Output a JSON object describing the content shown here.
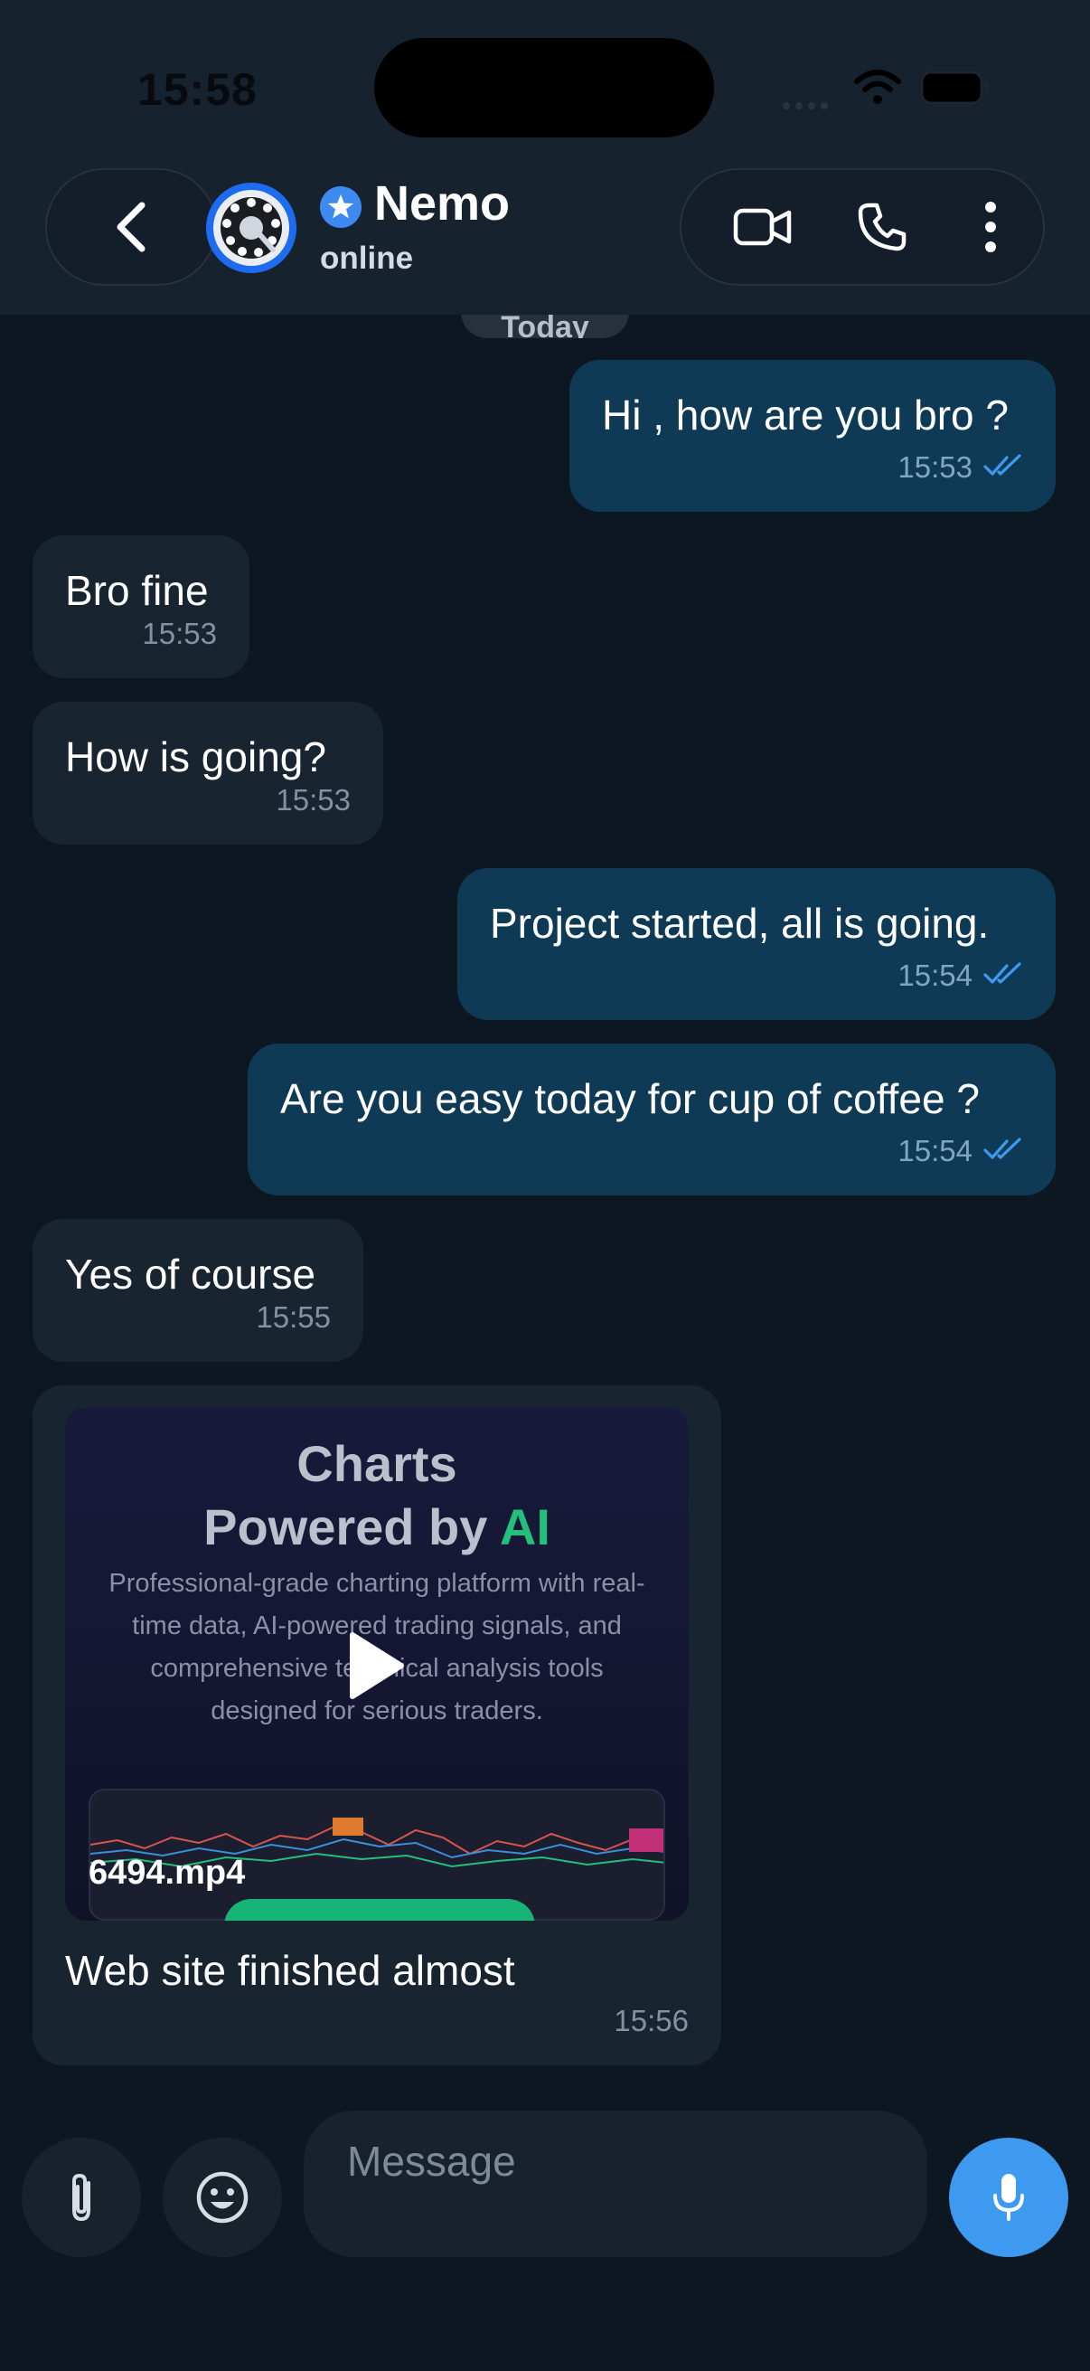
{
  "status_bar": {
    "time": "15:58"
  },
  "header": {
    "contact_name": "Nemo",
    "contact_status": "online",
    "icons": [
      "back-chevron-icon",
      "verified-star-icon",
      "video-call-icon",
      "phone-call-icon",
      "more-vertical-icon"
    ]
  },
  "date_separator": "Today",
  "messages": [
    {
      "direction": "outgoing",
      "text": "Hi , how are you bro ?",
      "time": "15:53",
      "read": true
    },
    {
      "direction": "incoming",
      "text": "Bro fine",
      "time": "15:53"
    },
    {
      "direction": "incoming",
      "text": "How is going?",
      "time": "15:53"
    },
    {
      "direction": "outgoing",
      "text": "Project started, all is going.",
      "time": "15:54",
      "read": true
    },
    {
      "direction": "outgoing",
      "text": "Are you easy today for cup of coffee ?",
      "time": "15:54",
      "read": true
    },
    {
      "direction": "incoming",
      "text": "Yes of course",
      "time": "15:55"
    },
    {
      "direction": "incoming",
      "type": "video",
      "thumbnail": {
        "title_line1": "Charts",
        "title_line2_prefix": "Powered by ",
        "title_line2_highlight": "AI",
        "description": "Professional-grade charting platform with real-time data, AI-powered trading signals, and comprehensive technical analysis tools designed for serious traders."
      },
      "file_name": "6494.mp4",
      "caption": "Web site finished almost",
      "time": "15:56"
    }
  ],
  "composer": {
    "placeholder": "Message"
  },
  "colors": {
    "background": "#0d1722",
    "header": "#17222f",
    "outgoing_bubble": "#0f3a56",
    "incoming_bubble": "#182430",
    "read_ticks": "#3d9af0",
    "accent": "#3d9af0",
    "ai_highlight": "#22c07a"
  }
}
